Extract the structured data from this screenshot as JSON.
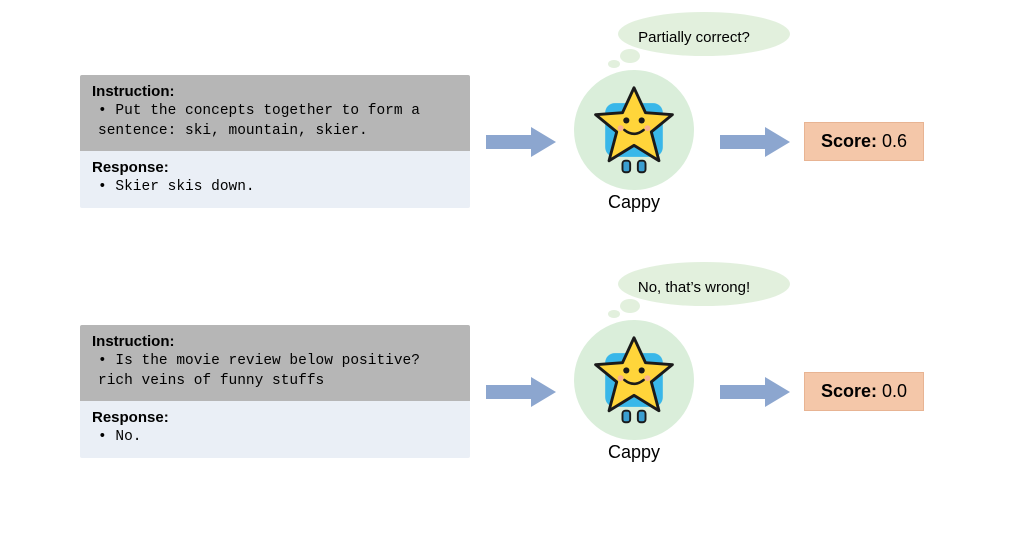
{
  "examples": [
    {
      "instruction_label": "Instruction:",
      "instruction_text": "Put the concepts together to form a sentence: ski, mountain, skier.",
      "response_label": "Response:",
      "response_text": "Skier skis down.",
      "thought": "Partially correct?",
      "agent_name": "Cappy",
      "score_label": "Score:",
      "score_value": "0.6"
    },
    {
      "instruction_label": "Instruction:",
      "instruction_text": "Is the movie review below positive? rich veins of funny stuffs",
      "response_label": "Response:",
      "response_text": "No.",
      "thought": "No, that’s wrong!",
      "agent_name": "Cappy",
      "score_label": "Score:",
      "score_value": "0.0"
    }
  ],
  "colors": {
    "arrow": "#8ca6cf",
    "bubble": "#e2f0dd",
    "circle": "#daeeda",
    "score_bg": "#f4c7a9"
  }
}
